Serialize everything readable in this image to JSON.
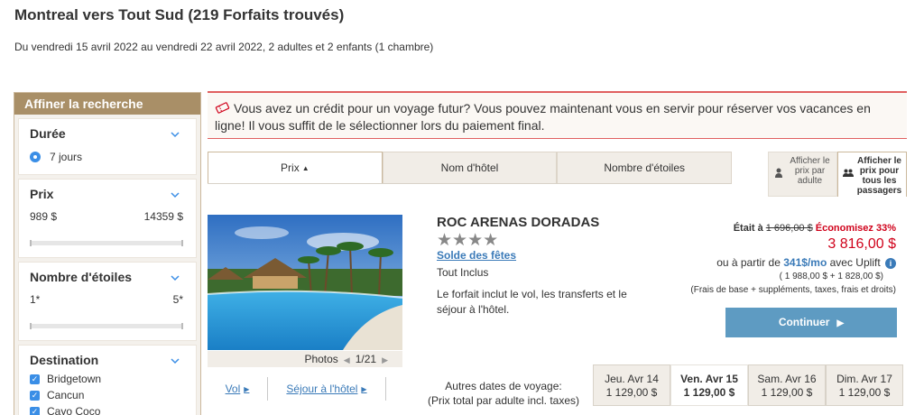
{
  "header": {
    "title": "Montreal vers Tout Sud (219 Forfaits trouvés)",
    "subtitle": "Du vendredi 15 avril 2022 au vendredi 22 avril 2022, 2 adultes et 2 enfants (1 chambre)"
  },
  "sidebar": {
    "title": "Affiner la recherche",
    "duration": {
      "title": "Durée",
      "option": "7 jours"
    },
    "price": {
      "title": "Prix",
      "min": "989 $",
      "max": "14359 $"
    },
    "stars": {
      "title": "Nombre d'étoiles",
      "min": "1*",
      "max": "5*"
    },
    "destination": {
      "title": "Destination",
      "items": [
        "Bridgetown",
        "Cancun",
        "Cayo Coco"
      ]
    }
  },
  "credit_banner": {
    "text": "Vous avez un crédit pour un voyage futur? Vous pouvez maintenant vous en servir pour réserver vos vacances en ligne! Il vous suffit de le sélectionner lors du paiement final.",
    "icon": "ticket-icon"
  },
  "sort_tabs": [
    {
      "label": "Prix",
      "active": true
    },
    {
      "label": "Nom d'hôtel",
      "active": false
    },
    {
      "label": "Nombre d'étoiles",
      "active": false
    }
  ],
  "price_toggle": {
    "per_adult": "Afficher le prix par adulte",
    "all_passengers": "Afficher le prix pour tous les passagers"
  },
  "hotel": {
    "name": "ROC ARENAS DORADAS",
    "stars_text": "★★★★",
    "star_rating": 4,
    "promo": "Solde des fêtes",
    "board": "Tout Inclus",
    "description": "Le forfait inclut le vol, les transferts et le séjour à l'hôtel.",
    "photos_label": "Photos",
    "photos_count": "1/21",
    "was_label": "Était à",
    "old_price": "1 696,00 $",
    "savings": "Économisez 33%",
    "price": "3 816,00 $",
    "uplift_prefix": "ou à partir de",
    "uplift_amount": "341$/mo",
    "uplift_suffix": "avec Uplift",
    "breakdown": "( 1 988,00 $ + 1 828,00 $)",
    "fees": "(Frais de base + suppléments, taxes, frais et droits)",
    "continue_label": "Continuer",
    "link_flight": "Vol",
    "link_stay": "Séjour à l'hôtel"
  },
  "other_dates": {
    "label_line1": "Autres dates de voyage:",
    "label_line2": "(Prix total par adulte incl. taxes)",
    "dates": [
      {
        "day": "Jeu. Avr 14",
        "price": "1 129,00 $",
        "selected": false
      },
      {
        "day": "Ven. Avr 15",
        "price": "1 129,00 $",
        "selected": true
      },
      {
        "day": "Sam. Avr 16",
        "price": "1 129,00 $",
        "selected": false
      },
      {
        "day": "Dim. Avr 17",
        "price": "1 129,00 $",
        "selected": false
      }
    ]
  },
  "colors": {
    "accent_brown": "#a98f67",
    "link_blue": "#3a7ab8",
    "price_red": "#d0021b",
    "button_blue": "#5e9bc2"
  }
}
